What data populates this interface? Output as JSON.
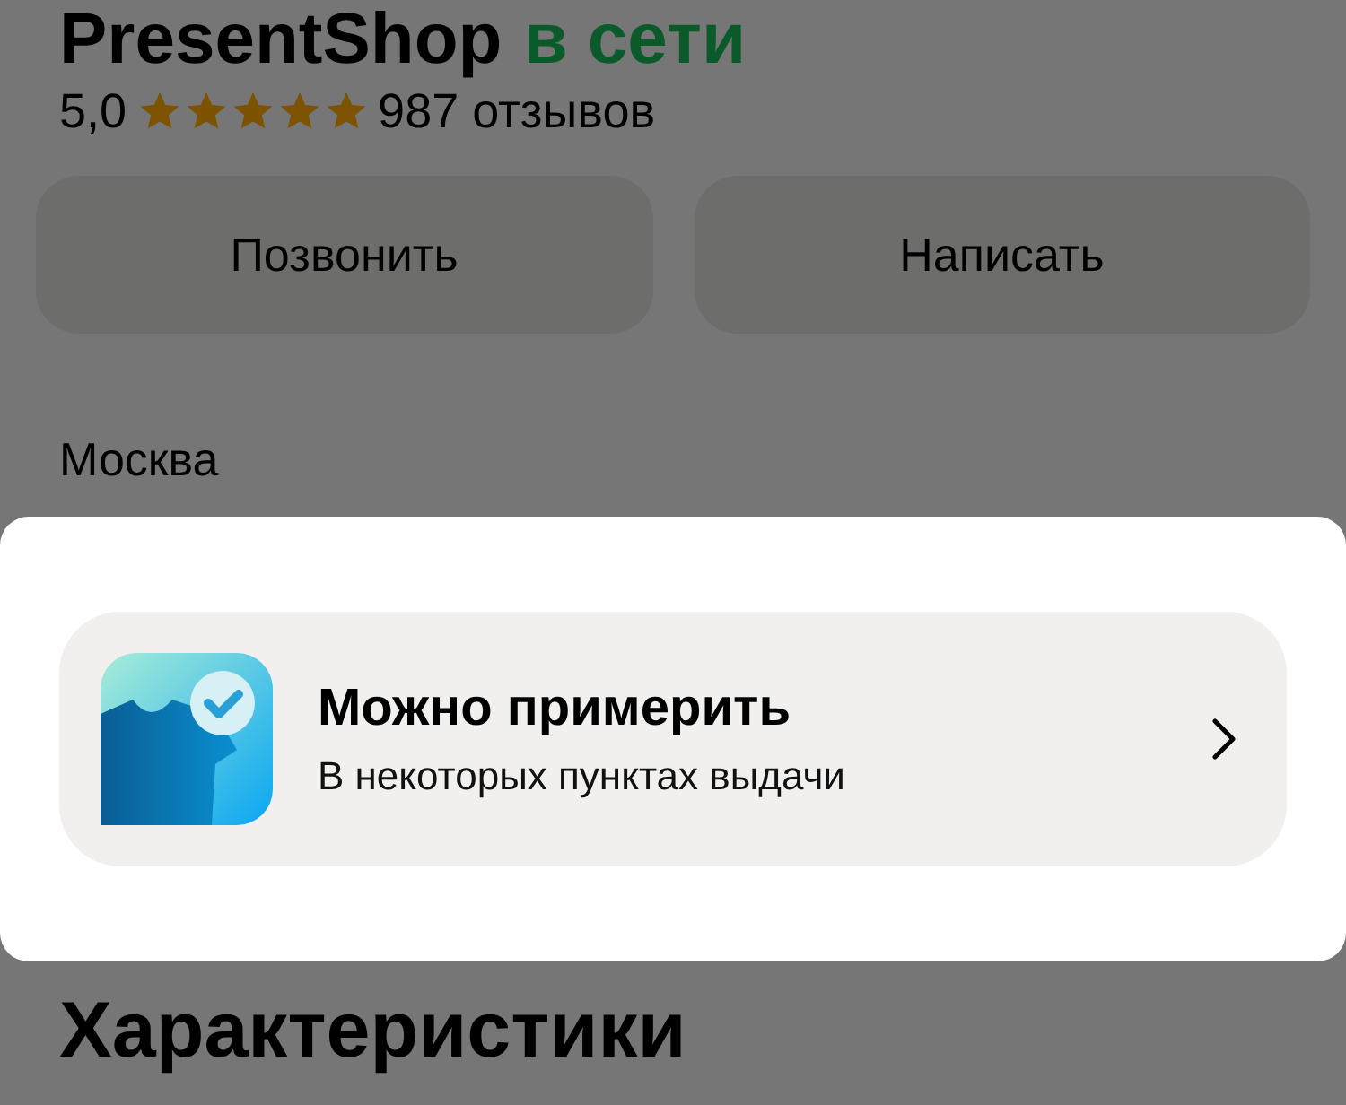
{
  "shop": {
    "name": "PresentShop",
    "status": "в сети"
  },
  "rating": {
    "score": "5,0",
    "stars": 5,
    "reviews": "987 отзывов"
  },
  "actions": [
    "Позвонить",
    "Написать"
  ],
  "city": "Москва",
  "fitting_card": {
    "title": "Можно примерить",
    "subtitle": "В некоторых пунктах выдачи"
  },
  "section_title": "Характеристики"
}
